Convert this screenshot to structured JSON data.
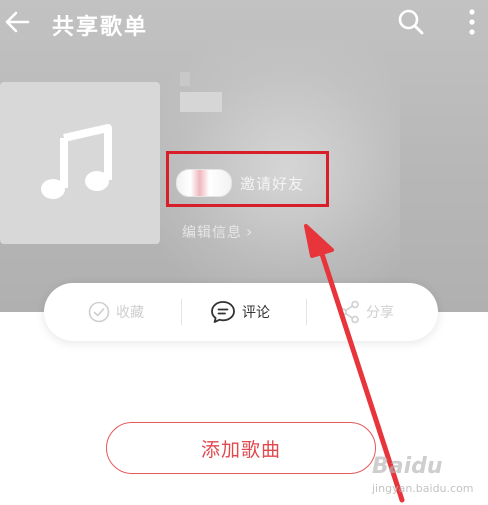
{
  "header": {
    "title": "共享歌单",
    "back_icon": "arrow-left-icon",
    "search_icon": "search-icon",
    "more_icon": "more-vertical-icon"
  },
  "playlist": {
    "cover_icon": "music-note-icon",
    "invite_label": "邀请好友",
    "edit_info_label": "编辑信息"
  },
  "actions": {
    "favorite_label": "收藏",
    "comment_label": "评论",
    "share_label": "分享"
  },
  "add_song_label": "添加歌曲",
  "watermark": {
    "brand": "Baidu",
    "sub": "jingyan.baidu.com"
  },
  "colors": {
    "accent_red": "#d81e28",
    "button_red": "#e04a4f"
  }
}
